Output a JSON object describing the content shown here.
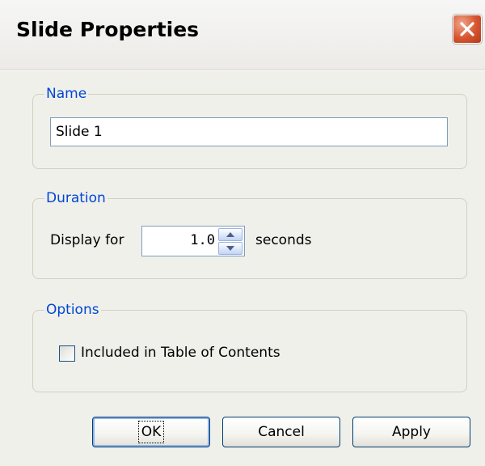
{
  "window": {
    "title": "Slide Properties"
  },
  "name_group": {
    "legend": "Name",
    "value": "Slide 1"
  },
  "duration_group": {
    "legend": "Duration",
    "display_label": "Display for",
    "value": "1.0",
    "unit_label": "seconds"
  },
  "options_group": {
    "legend": "Options",
    "toc_label": "Included in Table of Contents",
    "toc_checked": false
  },
  "buttons": {
    "ok": "OK",
    "cancel": "Cancel",
    "apply": "Apply"
  },
  "colors": {
    "legend_text": "#0046d5",
    "close_button": "#d6532f",
    "dialog_bg": "#f0f0eb"
  }
}
